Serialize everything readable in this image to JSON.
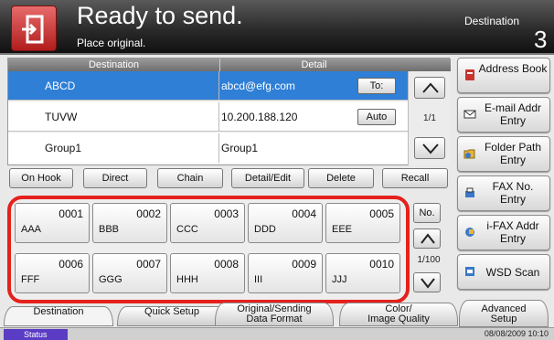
{
  "header": {
    "title": "Ready to send.",
    "subtitle": "Place original.",
    "destination_label": "Destination",
    "destination_count": "3"
  },
  "list": {
    "columns": [
      "Destination",
      "Detail"
    ],
    "rows": [
      {
        "name": "ABCD",
        "detail": "abcd@efg.com",
        "tag": "To:",
        "selected": true
      },
      {
        "name": "TUVW",
        "detail": "10.200.188.120",
        "tag": "Auto",
        "selected": false
      },
      {
        "name": "Group1",
        "detail": "Group1",
        "tag": "",
        "selected": false
      }
    ],
    "page": "1/1"
  },
  "side_buttons": [
    {
      "label": "Address Book",
      "icon": "address-book-icon"
    },
    {
      "label": "E-mail Addr Entry",
      "icon": "email-icon"
    },
    {
      "label": "Folder Path Entry",
      "icon": "folder-icon"
    },
    {
      "label": "FAX No. Entry",
      "icon": "fax-icon"
    },
    {
      "label": "i-FAX Addr Entry",
      "icon": "ifax-icon"
    },
    {
      "label": "WSD Scan",
      "icon": "wsd-scan-icon"
    }
  ],
  "actions": [
    "On Hook",
    "Direct",
    "Chain",
    "Detail/Edit",
    "Delete",
    "Recall"
  ],
  "one_touch": {
    "keys": [
      {
        "num": "0001",
        "name": "AAA"
      },
      {
        "num": "0002",
        "name": "BBB"
      },
      {
        "num": "0003",
        "name": "CCC"
      },
      {
        "num": "0004",
        "name": "DDD"
      },
      {
        "num": "0005",
        "name": "EEE"
      },
      {
        "num": "0006",
        "name": "FFF"
      },
      {
        "num": "0007",
        "name": "GGG"
      },
      {
        "num": "0008",
        "name": "HHH"
      },
      {
        "num": "0009",
        "name": "III"
      },
      {
        "num": "0010",
        "name": "JJJ"
      }
    ],
    "no_label": "No.",
    "page": "1/100"
  },
  "tabs": [
    {
      "lines": [
        "Destination"
      ]
    },
    {
      "lines": [
        "Quick Setup"
      ]
    },
    {
      "lines": [
        "Original/Sending",
        "Data Format"
      ]
    },
    {
      "lines": [
        "Color/",
        "Image Quality"
      ]
    },
    {
      "lines": [
        "Advanced",
        "Setup"
      ]
    }
  ],
  "status": {
    "label": "Status",
    "datetime": "08/08/2009  10:10"
  },
  "colors": {
    "accent_red": "#e5211c",
    "selection_blue": "#2f7fd6",
    "status_purple": "#5b3cc4"
  }
}
